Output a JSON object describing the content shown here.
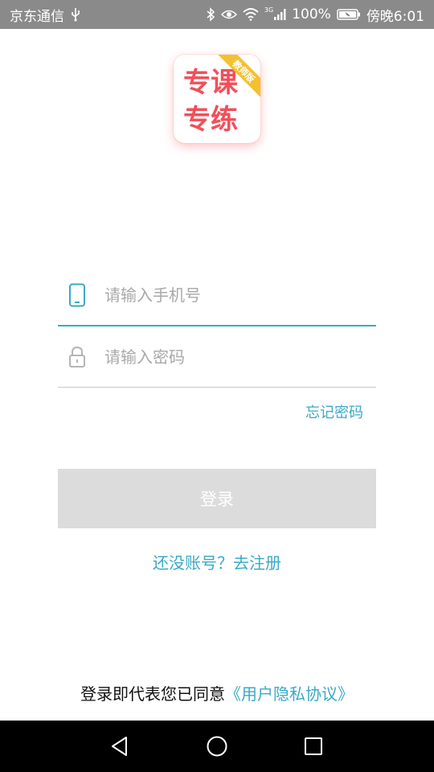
{
  "status_bar": {
    "carrier": "京东通信",
    "network": "3G",
    "battery": "100%",
    "time": "傍晚6:01"
  },
  "logo": {
    "line1": "专课",
    "line2": "专练",
    "badge": "教师版"
  },
  "login_form": {
    "phone_placeholder": "请输入手机号",
    "password_placeholder": "请输入密码",
    "forgot_password": "忘记密码",
    "login_button": "登录",
    "register_link": "还没账号？去注册"
  },
  "agreement": {
    "prefix": "登录即代表您已同意",
    "link": "《用户隐私协议》"
  },
  "colors": {
    "accent": "#3aa9c6",
    "brand": "#f0505a",
    "button_disabled": "#dcdcdc"
  }
}
